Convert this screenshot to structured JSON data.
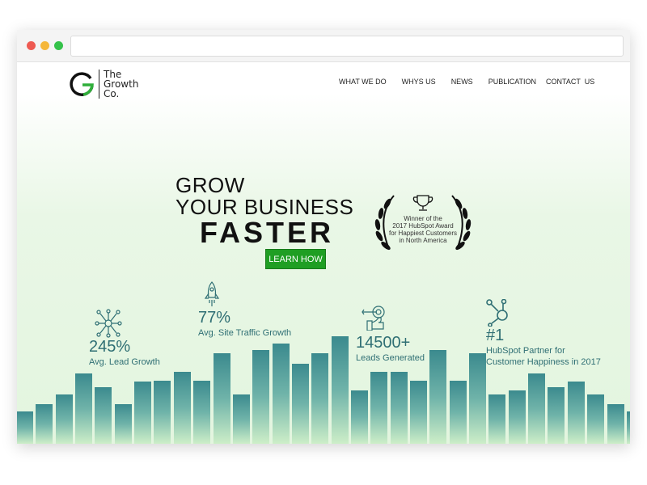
{
  "browser": {
    "dots": [
      "#ee5a52",
      "#f5b73b",
      "#35c24a"
    ]
  },
  "logo": {
    "text_lines": [
      "The",
      "Growth",
      "Co."
    ],
    "accent": "#2fae3a"
  },
  "nav": [
    "WHAT WE DO",
    "WHYS US",
    "NEWS",
    "PUBLICATION",
    "CONTACT  US"
  ],
  "hero": {
    "line1": "GROW",
    "line2": "YOUR BUSINESS",
    "line3": "FASTER",
    "cta": "LEARN HOW"
  },
  "award": {
    "lines": [
      "Winner of the",
      "2017 HubSpot Award",
      "for Happiest Customers",
      "in North America"
    ],
    "icon": "trophy-icon"
  },
  "stats": [
    {
      "value": "245%",
      "label": "Avg. Lead Growth",
      "icon": "network-icon"
    },
    {
      "value": "77%",
      "label": "Avg. Site Traffic Growth",
      "icon": "rocket-icon"
    },
    {
      "value": "14500+",
      "label": "Leads Generated",
      "icon": "target-thumbs-up-icon"
    },
    {
      "value": "#1",
      "label": "HubSpot Partner for Customer Happiness in 2017",
      "label_lines": [
        "HubSpot Partner for",
        "Customer Happiness in 2017"
      ],
      "icon": "hubspot-icon"
    }
  ],
  "colors": {
    "brand_green": "#1f9e23",
    "stat_teal": "#2f6f74",
    "bar_teal": "#3b8a8e"
  }
}
